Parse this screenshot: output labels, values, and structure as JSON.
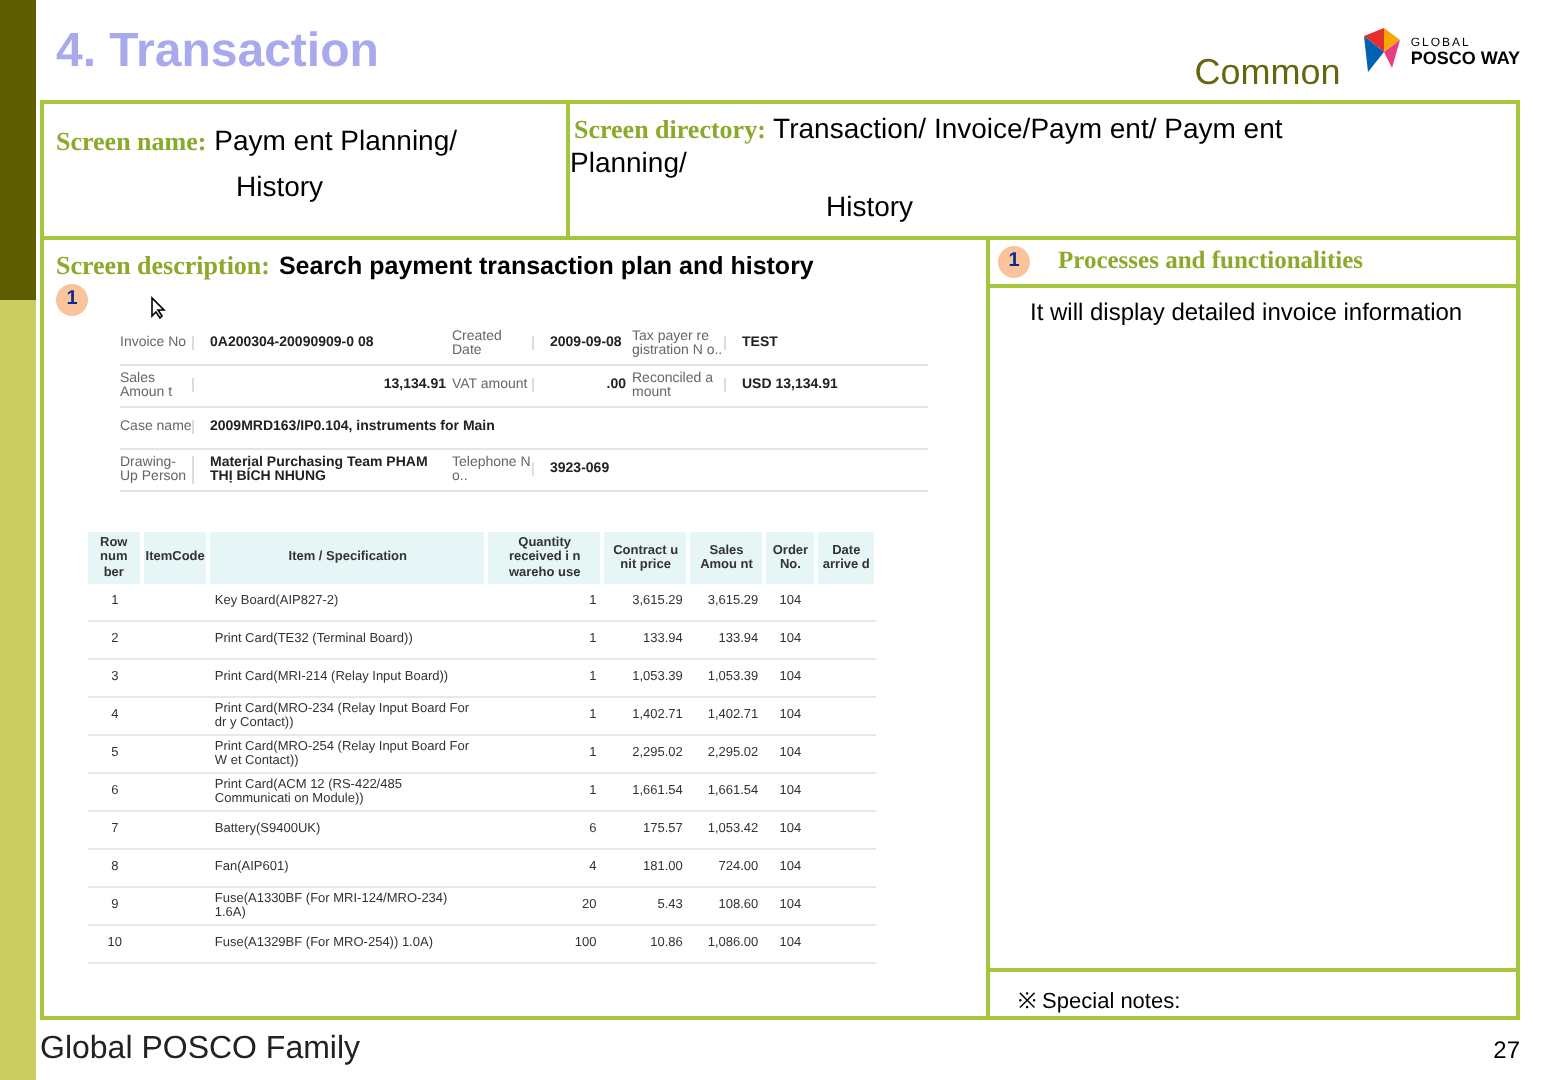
{
  "title": "4. Transaction",
  "category": "Common",
  "logo": {
    "small": "GLOBAL",
    "big": "POSCO WAY"
  },
  "screen_name": {
    "label": "Screen name:",
    "value": "Paym ent Planning/",
    "value_2": "History"
  },
  "screen_directory": {
    "label": "Screen directory:",
    "value": "Transaction/ Invoice/Paym ent/ Paym ent",
    "value_2": "Planning/",
    "value_3": "History"
  },
  "screen_description": {
    "label": "Screen description:",
    "value": "Search payment transaction plan and history",
    "marker": "1"
  },
  "processes": {
    "marker": "1",
    "title": "Processes and functionalities",
    "text": "It will display detailed invoice information"
  },
  "special_notes": "※ Special notes:",
  "footer": "Global POSCO Family",
  "page_number": "27",
  "app": {
    "info": [
      {
        "cells": [
          {
            "label": "Invoice No",
            "value": "0A200304-20090909-0 08"
          },
          {
            "label": "Created Date",
            "value": "2009-09-08"
          },
          {
            "label": "Tax payer re gistration N o..",
            "value": "TEST"
          }
        ]
      },
      {
        "cells": [
          {
            "label": "Sales Amoun t",
            "value": "13,134.91",
            "num": true
          },
          {
            "label": "VAT amount",
            "value": ".00",
            "num": true
          },
          {
            "label": "Reconciled a mount",
            "value": "USD 13,134.91"
          }
        ]
      },
      {
        "cells": [
          {
            "label": "Case name",
            "value": "2009MRD163/IP0.104, instruments for Main",
            "span": true
          }
        ]
      },
      {
        "cells": [
          {
            "label": "Drawing-Up Person",
            "value": "Material Purchasing Team PHAM THỊ BÍCH NHUNG"
          },
          {
            "label": "Telephone N o..",
            "value": "3923-069"
          }
        ]
      }
    ],
    "columns": [
      "Row num ber",
      "ItemCode",
      "Item / Specification",
      "Quantity received i n wareho use",
      "Contract u nit price",
      "Sales Amou nt",
      "Order No.",
      "Date arrive d"
    ],
    "rows": [
      [
        "1",
        "",
        "Key Board(AIP827-2)",
        "1",
        "3,615.29",
        "3,615.29",
        "104",
        ""
      ],
      [
        "2",
        "",
        "Print Card(TE32 (Terminal Board))",
        "1",
        "133.94",
        "133.94",
        "104",
        ""
      ],
      [
        "3",
        "",
        "Print Card(MRI-214 (Relay Input Board))",
        "1",
        "1,053.39",
        "1,053.39",
        "104",
        ""
      ],
      [
        "4",
        "",
        "Print Card(MRO-234 (Relay Input Board For dr y Contact))",
        "1",
        "1,402.71",
        "1,402.71",
        "104",
        ""
      ],
      [
        "5",
        "",
        "Print Card(MRO-254 (Relay Input Board For W et Contact))",
        "1",
        "2,295.02",
        "2,295.02",
        "104",
        ""
      ],
      [
        "6",
        "",
        "Print Card(ACM 12 (RS-422/485 Communicati on Module))",
        "1",
        "1,661.54",
        "1,661.54",
        "104",
        ""
      ],
      [
        "7",
        "",
        "Battery(S9400UK)",
        "6",
        "175.57",
        "1,053.42",
        "104",
        ""
      ],
      [
        "8",
        "",
        "Fan(AIP601)",
        "4",
        "181.00",
        "724.00",
        "104",
        ""
      ],
      [
        "9",
        "",
        "Fuse(A1330BF (For MRI-124/MRO-234) 1.6A)",
        "20",
        "5.43",
        "108.60",
        "104",
        ""
      ],
      [
        "10",
        "",
        "Fuse(A1329BF (For MRO-254)) 1.0A)",
        "100",
        "10.86",
        "1,086.00",
        "104",
        ""
      ]
    ]
  }
}
